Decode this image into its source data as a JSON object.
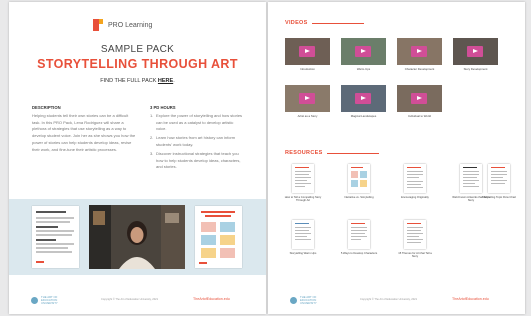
{
  "left_page": {
    "brand": "PRO Learning",
    "subtitle": "SAMPLE PACK",
    "title": "STORYTELLING THROUGH ART",
    "find_text": "FIND THE FULL PACK",
    "find_link": "HERE",
    "find_suffix": ".",
    "description_heading": "DESCRIPTION",
    "description_body": "Helping students tell their own stories can be a difficult task. In this PRO Pack, Lena Rodriguez will share a plethora of strategies that use storytelling as a way to develop student voice. Join her as she shows you how the power of stories can help students develop ideas, revise their work, and fine-tune their artistic processes.",
    "pd_heading": "3 PD HOURS",
    "pd_items": [
      {
        "num": "1.",
        "text": "Explore the power of storytelling and how stories can be used as a catalyst to develop artistic voice."
      },
      {
        "num": "2.",
        "text": "Learn how stories from art history can inform students' work today."
      },
      {
        "num": "3.",
        "text": "Discover instructional strategies that teach you how to help students develop ideas, characters, and stories."
      }
    ]
  },
  "footer": {
    "logo_text": "THE ART OF EDUCATION UNIVERSITY",
    "copyright": "Copyright © The Art of Education University, 2021",
    "link": "TheArtofEducation.edu"
  },
  "right_page": {
    "videos_heading": "VIDEOS",
    "videos": [
      "Introduction",
      "Warm-Ups",
      "Character Development",
      "Story Development",
      "Artist as a Story",
      "Magical Landscapes",
      "Individual to World"
    ],
    "resources_heading": "RESOURCES",
    "resources": [
      "How to Tell a Compelling Story Through Art",
      "Narrative vs. Storytelling",
      "Encouraging Originality",
      "Well-Known Artworks that Tell a Story",
      "Storytelling Topic Flow Chart",
      "Storytelling Warm-Ups",
      "5 Ways to Develop Characters",
      "15 Themes for Art that Tell a Story"
    ]
  },
  "colors": {
    "accent": "#e8503a",
    "brand_orange": "#f4a41e",
    "play_button": "#d04e97",
    "strip_background": "#dbe8ee",
    "footer_logo": "#6aa7c4"
  }
}
